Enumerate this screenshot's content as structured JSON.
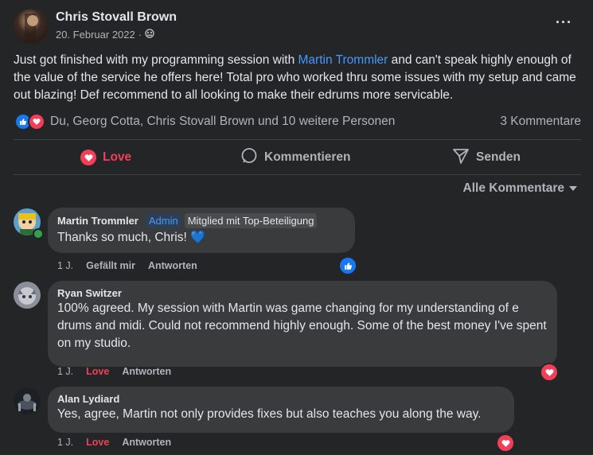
{
  "post": {
    "author": "Chris Stovall Brown",
    "date": "20. Februar 2022",
    "separator": "·",
    "text_before": "Just got finished with my programming session with ",
    "mention": "Martin Trommler",
    "text_after": " and can't speak highly enough of the value of the service he offers here! Total pro who worked thru some issues with my setup and came out blazing! Def recommend to all looking to make their edrums more servicable.",
    "reactions_summary": "Du, Georg Cotta, Chris Stovall Brown und 10 weitere Personen",
    "comment_count": "3 Kommentare",
    "more_label": "···"
  },
  "actions": {
    "love": "Love",
    "comment": "Kommentieren",
    "send": "Senden"
  },
  "filter_label": "Alle Kommentare",
  "comments": [
    {
      "name": "Martin Trommler",
      "badges": [
        "Admin",
        "Mitglied mit Top-Beteiligung"
      ],
      "text": "Thanks so much, Chris! 💙",
      "time": "1 J.",
      "reaction_label": "Gefällt mir",
      "reply": "Antworten"
    },
    {
      "name": "Ryan Switzer",
      "text": "100% agreed. My session with Martin was game changing for my understanding of e drums and midi. Could not recommend highly enough. Some of the best money I've spent on my studio.",
      "time": "1 J.",
      "reaction_label": "Love",
      "reply": "Antworten"
    },
    {
      "name": "Alan Lydiard",
      "text": "Yes, agree, Martin not only provides fixes but also teaches you along the way.",
      "time": "1 J.",
      "reaction_label": "Love",
      "reply": "Antworten"
    }
  ],
  "colors": {
    "background": "#242526",
    "bubble": "#3a3b3c",
    "accent_blue": "#4599ff",
    "love_red": "#f33e58"
  }
}
